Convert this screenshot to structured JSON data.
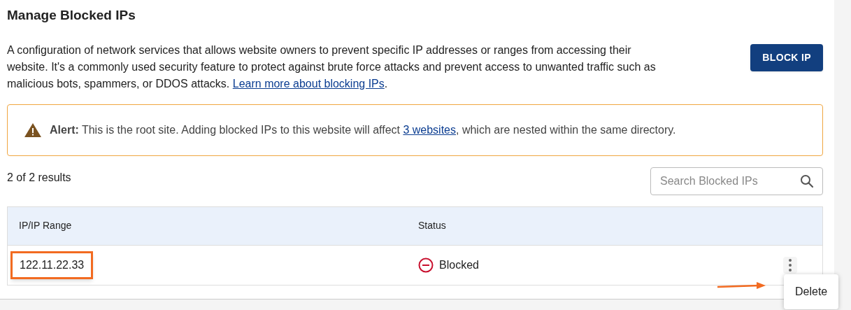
{
  "title": "Manage Blocked IPs",
  "description": {
    "text": "A configuration of network services that allows website owners to prevent specific IP addresses or ranges from accessing their website. It's a commonly used security feature to protect against brute force attacks and prevent access to unwanted traffic such as malicious bots, spammers, or DDOS attacks. ",
    "link": "Learn more about blocking IPs",
    "after": "."
  },
  "block_button": "BLOCK IP",
  "alert": {
    "text": "**Alert:** This is the root site. Adding blocked IPs to this website will affect ",
    "link": "3 websites",
    "after": ", which are nested within the same directory."
  },
  "results": "2 of 2 results",
  "search": {
    "placeholder": "Search Blocked IPs"
  },
  "table": {
    "columns": [
      "IP/IP Range",
      "Status"
    ],
    "rows": [
      {
        "ip": "122.11.22.33",
        "status": "Blocked",
        "kind": "blocked",
        "highlighted": true,
        "menu_open": true
      }
    ]
  },
  "row_menu": {
    "items": [
      "Delete"
    ]
  }
}
